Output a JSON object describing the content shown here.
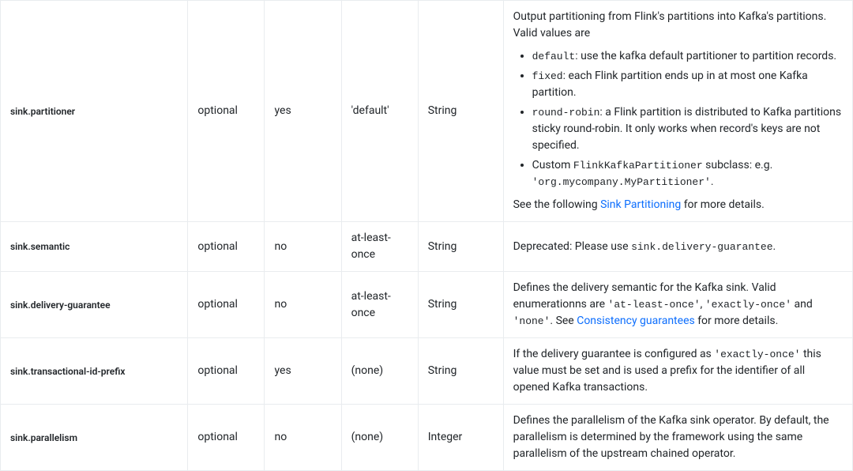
{
  "rows": [
    {
      "name": "sink.partitioner",
      "required": "optional",
      "forward": "yes",
      "default": "'default'",
      "type": "String",
      "desc": {
        "intro": "Output partitioning from Flink's partitions into Kafka's partitions. Valid values are",
        "bullets": [
          {
            "code": "default",
            "text": ": use the kafka default partitioner to partition records."
          },
          {
            "code": "fixed",
            "text": ": each Flink partition ends up in at most one Kafka partition."
          },
          {
            "code": "round-robin",
            "text": ": a Flink partition is distributed to Kafka partitions sticky round-robin. It only works when record's keys are not specified."
          },
          {
            "customPrefix": "Custom ",
            "code": "FlinkKafkaPartitioner",
            "text": " subclass: e.g. ",
            "code2": "'org.mycompany.MyPartitioner'",
            "trail": "."
          }
        ],
        "seePrefix": "See the following ",
        "seeLink": "Sink Partitioning",
        "seeSuffix": " for more details."
      }
    },
    {
      "name": "sink.semantic",
      "required": "optional",
      "forward": "no",
      "default": "at-least-once",
      "type": "String",
      "desc": {
        "deprecatedPrefix": "Deprecated: Please use ",
        "deprecatedCode": "sink.delivery-guarantee",
        "deprecatedSuffix": "."
      }
    },
    {
      "name": "sink.delivery-guarantee",
      "required": "optional",
      "forward": "no",
      "default": "at-least-once",
      "type": "String",
      "desc": {
        "p1a": "Defines the delivery semantic for the Kafka sink. Valid enumerationns are ",
        "c1": "'at-least-once'",
        "p1b": ", ",
        "c2": "'exactly-once'",
        "p1c": " and ",
        "c3": "'none'",
        "p1d": ". See ",
        "link": "Consistency guarantees",
        "p1e": " for more details."
      }
    },
    {
      "name": "sink.transactional-id-prefix",
      "required": "optional",
      "forward": "yes",
      "default": "(none)",
      "type": "String",
      "desc": {
        "p1a": "If the delivery guarantee is configured as ",
        "c1": "'exactly-once'",
        "p1b": " this value must be set and is used a prefix for the identifier of all opened Kafka transactions."
      }
    },
    {
      "name": "sink.parallelism",
      "required": "optional",
      "forward": "no",
      "default": "(none)",
      "type": "Integer",
      "desc": {
        "plain": "Defines the parallelism of the Kafka sink operator. By default, the parallelism is determined by the framework using the same parallelism of the upstream chained operator."
      }
    }
  ]
}
